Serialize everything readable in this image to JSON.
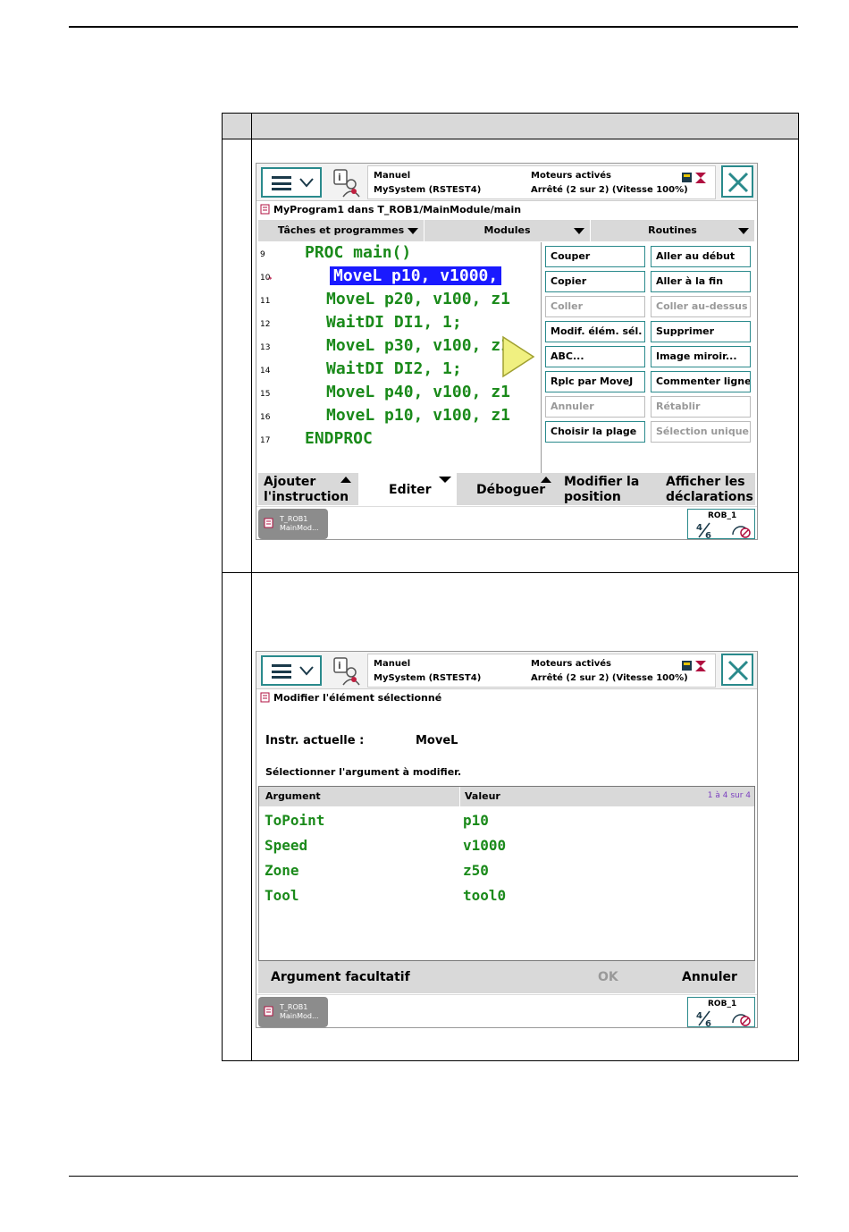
{
  "status": {
    "mode": "Manuel",
    "system": "MySystem (RSTEST4)",
    "motors": "Moteurs activés",
    "state": "Arrêté (2 sur 2) (Vitesse 100%)"
  },
  "screen1": {
    "title": "MyProgram1 dans T_ROB1/MainModule/main",
    "nav": [
      "Tâches et programmes",
      "Modules",
      "Routines"
    ],
    "code": [
      {
        "ln": "9",
        "text": "PROC main()",
        "indent": 0,
        "selected": false
      },
      {
        "ln": "10",
        "text": "MoveL p10, v1000,",
        "indent": 2,
        "selected": true
      },
      {
        "ln": "11",
        "text": "MoveL p20, v100, z1",
        "indent": 1,
        "selected": false
      },
      {
        "ln": "12",
        "text": "WaitDI DI1, 1;",
        "indent": 1,
        "selected": false
      },
      {
        "ln": "13",
        "text": "MoveL p30, v100, z1",
        "indent": 1,
        "selected": false
      },
      {
        "ln": "14",
        "text": "WaitDI DI2, 1;",
        "indent": 1,
        "selected": false
      },
      {
        "ln": "15",
        "text": "MoveL p40, v100, z1",
        "indent": 1,
        "selected": false
      },
      {
        "ln": "16",
        "text": "MoveL p10, v100, z1",
        "indent": 1,
        "selected": false
      },
      {
        "ln": "17",
        "text": "ENDPROC",
        "indent": 0,
        "selected": false
      }
    ],
    "popup": [
      {
        "label": "Couper",
        "enabled": true
      },
      {
        "label": "Aller au début",
        "enabled": true
      },
      {
        "label": "Copier",
        "enabled": true
      },
      {
        "label": "Aller à la fin",
        "enabled": true
      },
      {
        "label": "Coller",
        "enabled": false
      },
      {
        "label": "Coller au-dessus",
        "enabled": false
      },
      {
        "label": "Modif. élém. sél.",
        "enabled": true
      },
      {
        "label": "Supprimer",
        "enabled": true
      },
      {
        "label": "ABC...",
        "enabled": true
      },
      {
        "label": "Image miroir...",
        "enabled": true
      },
      {
        "label": "Rplc par MoveJ",
        "enabled": true
      },
      {
        "label": "Commenter ligne",
        "enabled": true
      },
      {
        "label": "Annuler",
        "enabled": false
      },
      {
        "label": "Rétablir",
        "enabled": false
      },
      {
        "label": "Choisir la plage",
        "enabled": true
      },
      {
        "label": "Sélection unique",
        "enabled": false
      }
    ],
    "bottom": {
      "add_line1": "Ajouter",
      "add_line2": "l'instruction",
      "edit": "Editer",
      "debug": "Déboguer",
      "modify_line1": "Modifier la",
      "modify_line2": "position",
      "show_line1": "Afficher les",
      "show_line2": "déclarations"
    }
  },
  "taskbar": {
    "task_line1": "T_ROB1",
    "task_line2": "MainMod...",
    "robot": "ROB_1"
  },
  "screen2": {
    "title": "Modifier l'élément sélectionné",
    "instr_label": "Instr. actuelle :",
    "instr_value": "MoveL",
    "select_prompt": "Sélectionner l'argument à modifier.",
    "col_argument": "Argument",
    "col_value": "Valeur",
    "range": "1 à 4 sur 4",
    "args": [
      {
        "name": "ToPoint",
        "value": "p10"
      },
      {
        "name": "Speed",
        "value": "v1000"
      },
      {
        "name": "Zone",
        "value": "z50"
      },
      {
        "name": "Tool",
        "value": "tool0"
      }
    ],
    "optional": "Argument facultatif",
    "ok": "OK",
    "cancel": "Annuler"
  },
  "colors": {
    "accent": "#2a8a8c",
    "code_green": "#1a8a1a",
    "selection": "#1a1aff"
  }
}
